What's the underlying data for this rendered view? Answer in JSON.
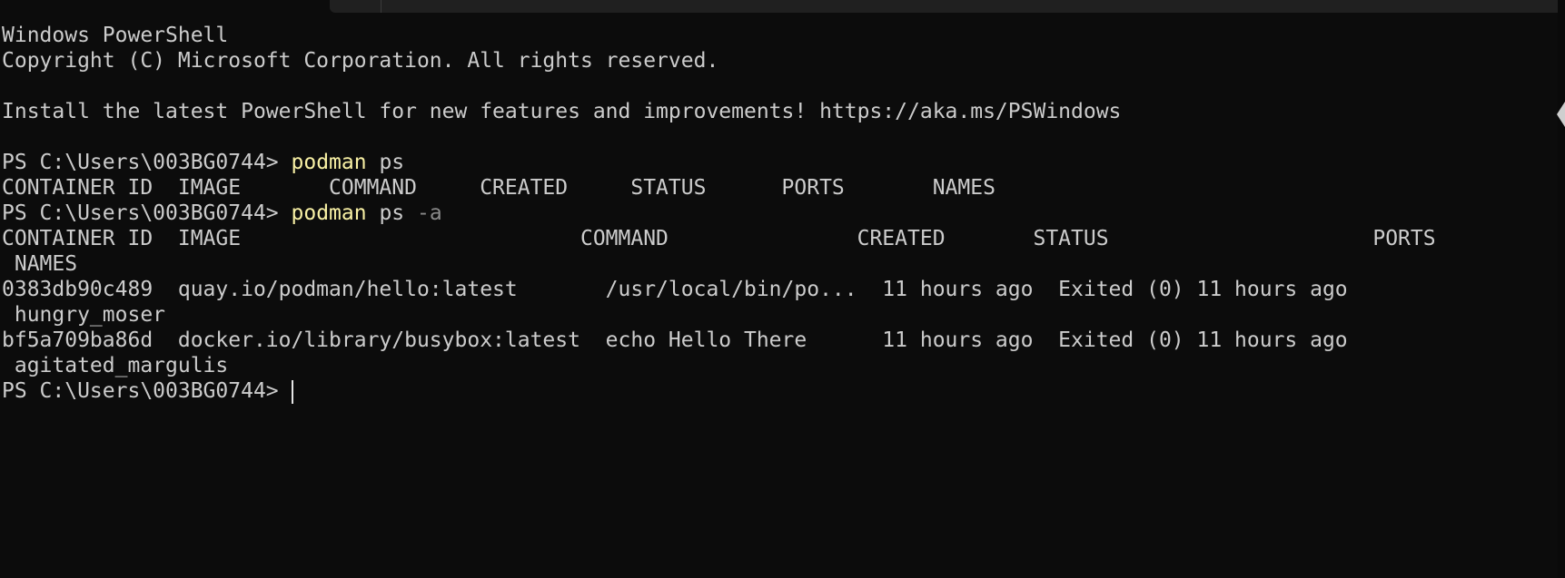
{
  "terminal": {
    "banner_line1": "Windows PowerShell",
    "banner_line2": "Copyright (C) Microsoft Corporation. All rights reserved.",
    "install_msg": "Install the latest PowerShell for new features and improvements! https://aka.ms/PSWindows",
    "prompt": "PS C:\\Users\\003BG0744> ",
    "cmd1": {
      "program": "podman",
      "args": " ps"
    },
    "ps_header": "CONTAINER ID  IMAGE       COMMAND     CREATED     STATUS      PORTS       NAMES",
    "cmd2": {
      "program": "podman",
      "args": " ps",
      "flag": " -a"
    },
    "psa_header": "CONTAINER ID  IMAGE                           COMMAND               CREATED       STATUS                     PORTS",
    "psa_header_wrap": " NAMES",
    "rows": [
      {
        "line": "0383db90c489  quay.io/podman/hello:latest       /usr/local/bin/po...  11 hours ago  Exited (0) 11 hours ago",
        "wrap": " hungry_moser"
      },
      {
        "line": "bf5a709ba86d  docker.io/library/busybox:latest  echo Hello There      11 hours ago  Exited (0) 11 hours ago",
        "wrap": " agitated_margulis"
      }
    ]
  },
  "colors": {
    "background": "#0c0c0c",
    "foreground": "#cccccc",
    "command": "#f9f1a5",
    "parameter": "#8a8a8a"
  }
}
